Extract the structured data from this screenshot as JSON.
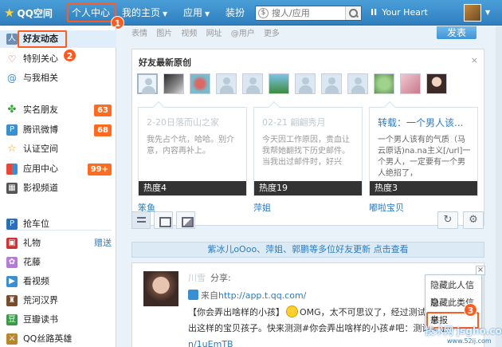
{
  "topnav": {
    "logo_text": "QQ空间",
    "personal_center": "个人中心",
    "my_home": "我的主页",
    "apps": "应用",
    "decorate": "装扮",
    "search_placeholder": "搜人/应用",
    "music_title": "Your Heart",
    "marker_1": "1"
  },
  "sidebar": {
    "items": [
      {
        "label": "好友动态",
        "icon": "friends-icon"
      },
      {
        "label": "特别关心",
        "icon": "heart-icon"
      },
      {
        "label": "与我相关",
        "icon": "at-icon"
      },
      {
        "label": "实名朋友",
        "icon": "clover-icon",
        "count": "63"
      },
      {
        "label": "腾讯微博",
        "icon": "weibo-icon",
        "count": "68"
      },
      {
        "label": "认证空间",
        "icon": "star-icon"
      },
      {
        "label": "应用中心",
        "icon": "app-grid-icon",
        "count": "99+"
      },
      {
        "label": "影视频道",
        "icon": "film-icon"
      },
      {
        "label": "抢车位",
        "icon": "parking-icon"
      },
      {
        "label": "礼物",
        "icon": "gift-icon",
        "extra": "赠送"
      },
      {
        "label": "花藤",
        "icon": "flower-icon"
      },
      {
        "label": "看视频",
        "icon": "video-icon"
      },
      {
        "label": "荒河汉界",
        "icon": "chess-icon"
      },
      {
        "label": "豆瓣读书",
        "icon": "book-icon"
      },
      {
        "label": "QQ丝路英雄",
        "icon": "game-icon"
      }
    ],
    "marker_2": "2"
  },
  "main": {
    "post_tools": [
      "表情",
      "图片",
      "视频",
      "网址",
      "@用户",
      "更多"
    ],
    "publish": "发表",
    "original_card": {
      "title": "好友最新原创",
      "close": "×",
      "articles": [
        {
          "title": "2-20日落而山之家",
          "body": "我先占个坑，哈哈。别介意，内容再补上。",
          "heat": "热度4",
          "author": "笨鱼",
          "title_faded": true
        },
        {
          "title": "02-21 翩翩秀月",
          "body": "今天因工作原因，贵血让我帮她翻找下历史邮件。当我出过邮件时，好兴",
          "heat": "热度19",
          "author": "萍姐",
          "title_faded": true
        },
        {
          "title": "转载：一个男人该...",
          "body": "一个男人该有的气质（马云原话)na.na主义[/url]一个男人，一定要有一个男人绝招了，",
          "heat": "热度3",
          "author": "嘟啦宝贝",
          "title_faded": false
        }
      ]
    },
    "notice": "紫冰儿oOoo、萍姐、郭鹏等多位好友更新 点击查看",
    "feed": {
      "name": "川雪",
      "share": "分享:",
      "from_label": "来自",
      "from_link": "http://app.t.qq.com/",
      "text_1": "【你会弄出啥样的小孩】",
      "text_2": "OMG，太不可思议了，经过测试原来",
      "text_3": "出这样的宝贝孩子。快来测测#你会弄出啥样的小孩#吧：测试网址",
      "text_link": "n/1uEmTB"
    },
    "context_menu": {
      "items": [
        "隐藏此人信息",
        "隐藏此类信息",
        "举报"
      ],
      "marker_3": "3"
    }
  },
  "watermark": {
    "line1": "技术网 jsgho.com",
    "line2": "www.52ij.com"
  },
  "colors": {
    "nav_blue": "#2f7fbf",
    "highlight_orange": "#ff5a1f",
    "link_blue": "#2c7bbf",
    "count_orange": "#ff6c1f"
  }
}
